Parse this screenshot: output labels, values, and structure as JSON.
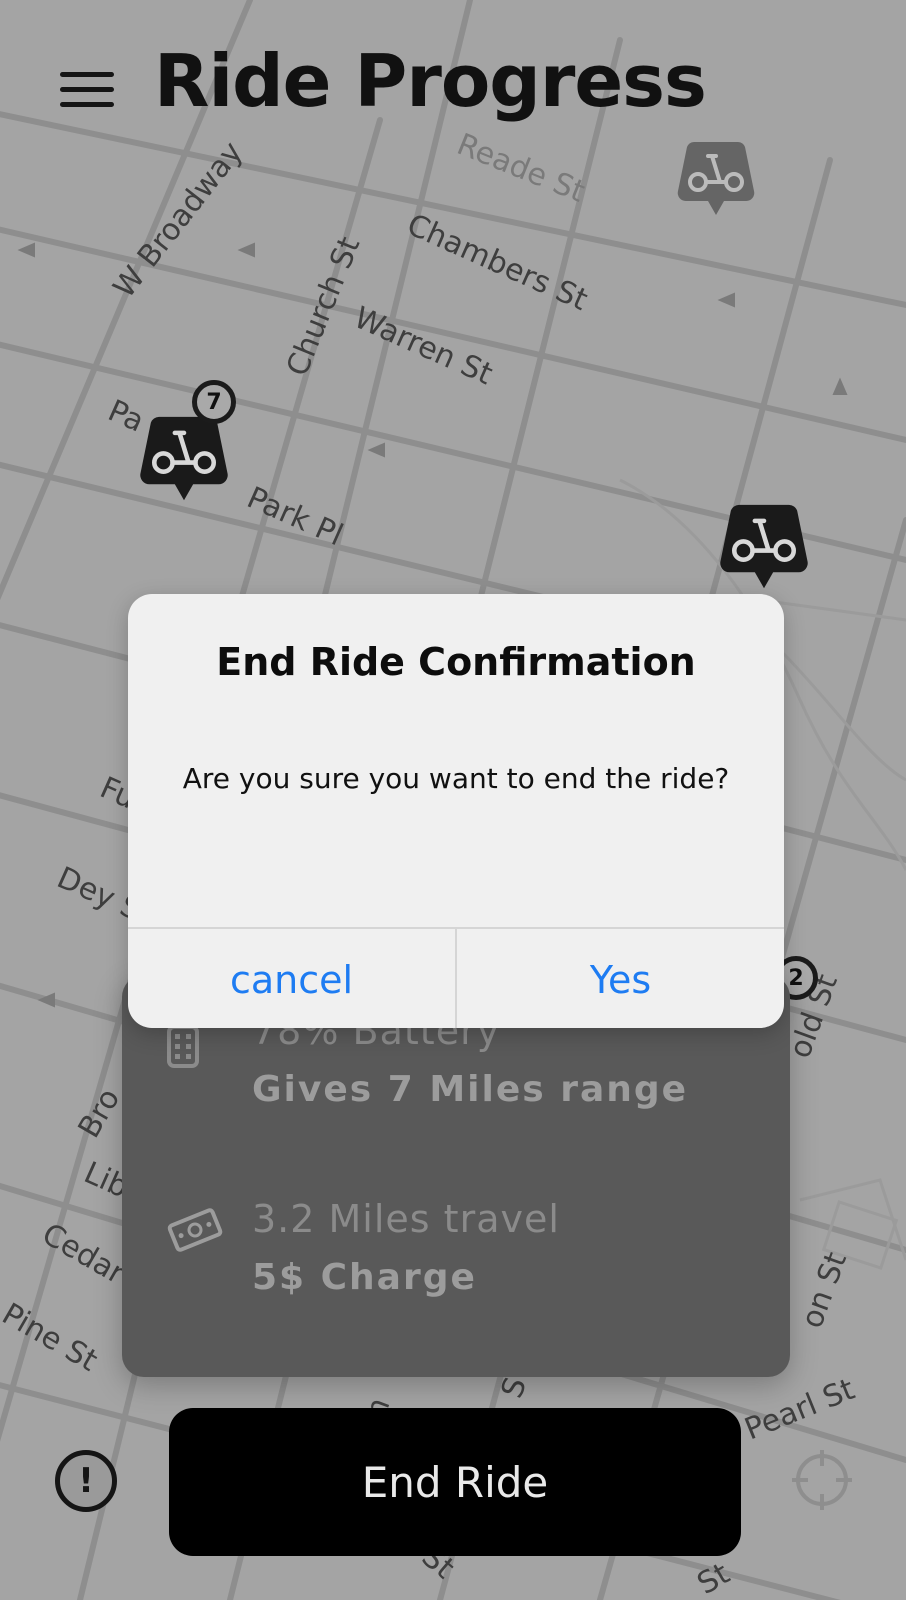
{
  "header": {
    "title": "Ride Progress"
  },
  "map": {
    "streets": [
      "W Broadway",
      "Church St",
      "Reade St",
      "Chambers St",
      "Warren St",
      "Park Pl",
      "Pa",
      "Fu",
      "Dey S",
      "Bro",
      "Lib",
      "Cedar S",
      "Pine St",
      "old St",
      "Pearl St",
      "on St",
      "m",
      "S",
      "St",
      "St"
    ],
    "clusters": {
      "park_place": "7",
      "right_edge": "2"
    }
  },
  "ride_info": {
    "battery_label": "78% Battery",
    "range_label": "Gives 7 Miles range",
    "distance_label": "3.2 Miles travel",
    "charge_label": "5$ Charge"
  },
  "dialog": {
    "title": "End Ride Confirmation",
    "message": "Are you sure you want to end the ride?",
    "cancel_label": "cancel",
    "confirm_label": "Yes"
  },
  "footer": {
    "end_ride_label": "End Ride",
    "alert_symbol": "!"
  },
  "icons": {
    "menu": "hamburger-icon",
    "marker": "scooter-marker-icon",
    "battery": "battery-icon",
    "charge": "money-icon",
    "report": "alert-icon",
    "locate": "crosshair-icon"
  },
  "colors": {
    "map_background": "#a4a4a4",
    "info_card": "#595959",
    "dialog_background": "#f0f0f0",
    "dialog_action": "#1e7cf2",
    "end_ride_button": "#000000"
  }
}
